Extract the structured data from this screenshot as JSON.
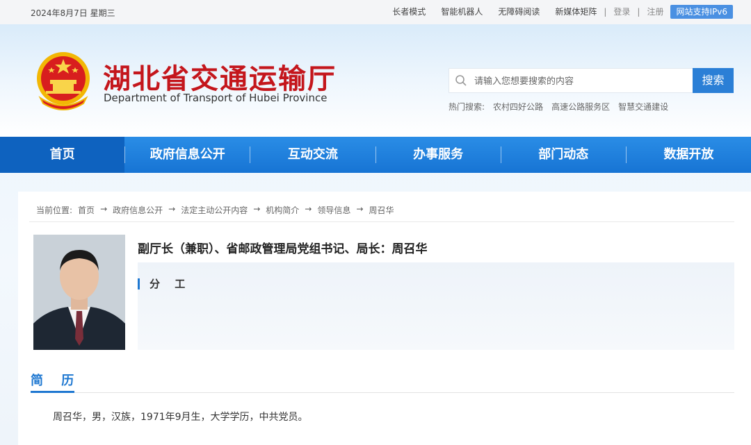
{
  "topbar": {
    "date": "2024年8月7日 星期三",
    "links": [
      "长者模式",
      "智能机器人",
      "无障碍阅读",
      "新媒体矩阵"
    ],
    "login": "登录",
    "register": "注册",
    "ipv6": "网站支持IPv6"
  },
  "header": {
    "title": "湖北省交通运输厅",
    "subtitle": "Department of Transport of Hubei Province",
    "search_placeholder": "请输入您想要搜索的内容",
    "search_button": "搜索",
    "hot_label": "热门搜索:",
    "hot_items": [
      "农村四好公路",
      "高速公路服务区",
      "智慧交通建设"
    ]
  },
  "nav": [
    "首页",
    "政府信息公开",
    "互动交流",
    "办事服务",
    "部门动态",
    "数据开放"
  ],
  "breadcrumb": {
    "label": "当前位置:",
    "items": [
      "首页",
      "政府信息公开",
      "法定主动公开内容",
      "机构简介",
      "领导信息",
      "周召华"
    ],
    "arrow": "→"
  },
  "leader": {
    "title": "副厅长（兼职）、省邮政管理局党组书记、局长：周召华",
    "duty_label": "分 工"
  },
  "resume": {
    "heading": "简 历",
    "text": "周召华，男，汉族，1971年9月生，大学学历，中共党员。"
  },
  "colors": {
    "brand_red": "#c4161c",
    "nav_blue": "#1f7fd9",
    "accent_blue": "#1f78d1"
  }
}
